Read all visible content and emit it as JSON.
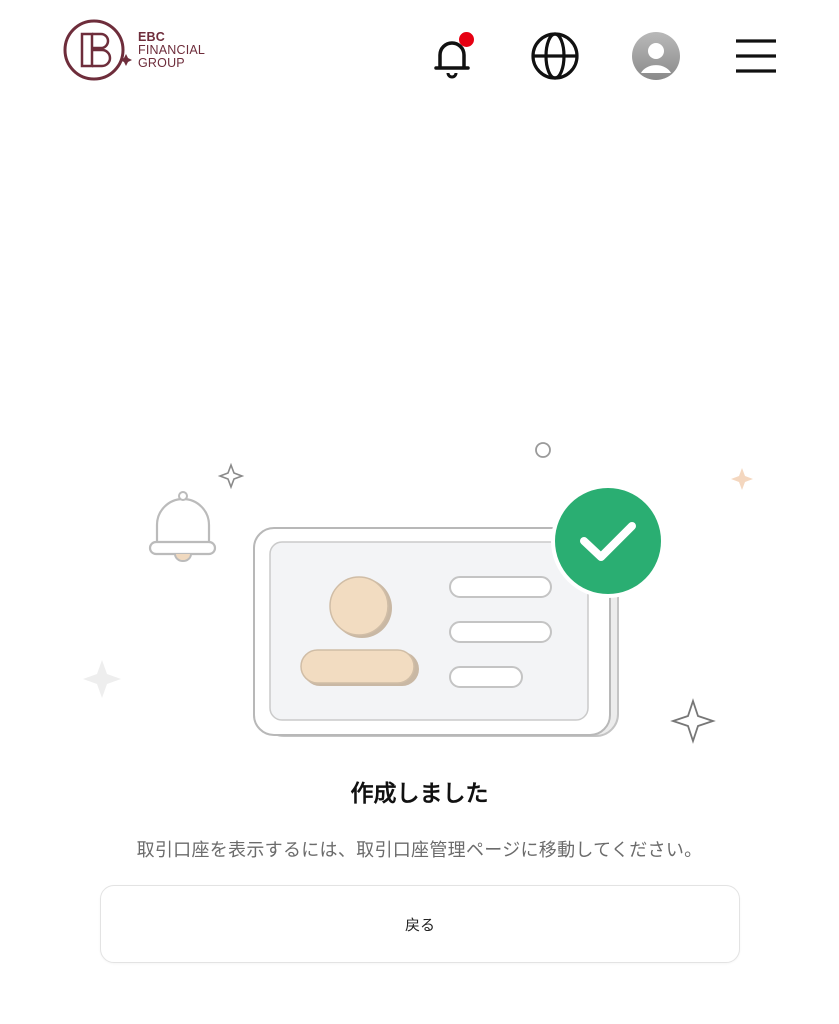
{
  "header": {
    "logo_lines": [
      "EBC",
      "FINANCIAL",
      "GROUP"
    ],
    "brand_color": "#6e2d3b",
    "icons": {
      "notifications": "bell-icon",
      "language": "globe-icon",
      "account": "user-avatar-icon",
      "menu": "hamburger-menu-icon"
    },
    "notification_dot_color": "#e60012"
  },
  "result": {
    "title": "作成しました",
    "message": "取引口座を表示するには、取引口座管理ページに移動してください。",
    "success_color": "#2aae72",
    "back_button_label": "戻る"
  }
}
